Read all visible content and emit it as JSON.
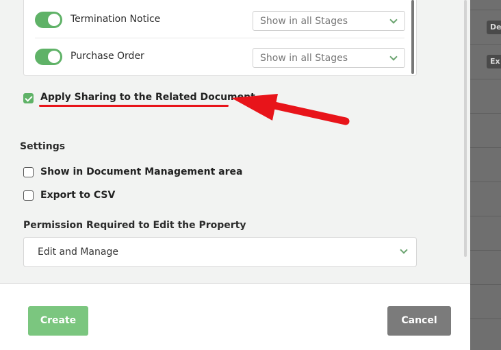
{
  "documents": [
    {
      "label": "Termination Notice",
      "enabled": true,
      "stage": "Show in all Stages"
    },
    {
      "label": "Purchase Order",
      "enabled": true,
      "stage": "Show in all Stages"
    }
  ],
  "apply_sharing": {
    "label": "Apply Sharing to the Related Document",
    "checked": true
  },
  "settings": {
    "title": "Settings",
    "show_in_dm": {
      "label": "Show in Document Management area",
      "checked": false
    },
    "export_csv": {
      "label": "Export to CSV",
      "checked": false
    }
  },
  "permission": {
    "label": "Permission Required to Edit the Property",
    "value": "Edit and Manage"
  },
  "footer": {
    "create_label": "Create",
    "cancel_label": "Cancel"
  },
  "backdrop": {
    "chips": [
      "De",
      "Ex"
    ]
  },
  "colors": {
    "accent": "#5fb267",
    "annotation": "#e8141a"
  }
}
